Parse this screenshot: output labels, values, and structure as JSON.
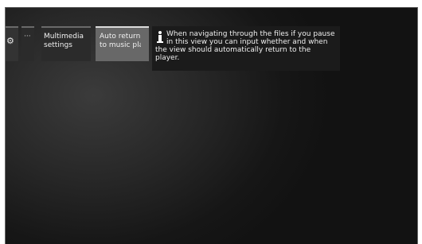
{
  "tabs": {
    "settings_icon": "gear-icon",
    "more_label": "···",
    "multimedia": {
      "line1": "Multimedia",
      "line2": "settings"
    },
    "auto_return": {
      "line1": "Auto return",
      "line2": "to music pla"
    }
  },
  "tooltip": {
    "icon": "info-icon",
    "text": "When navigating through the files if you pause in this view you can input whether and when the view should automatically return to the player."
  }
}
